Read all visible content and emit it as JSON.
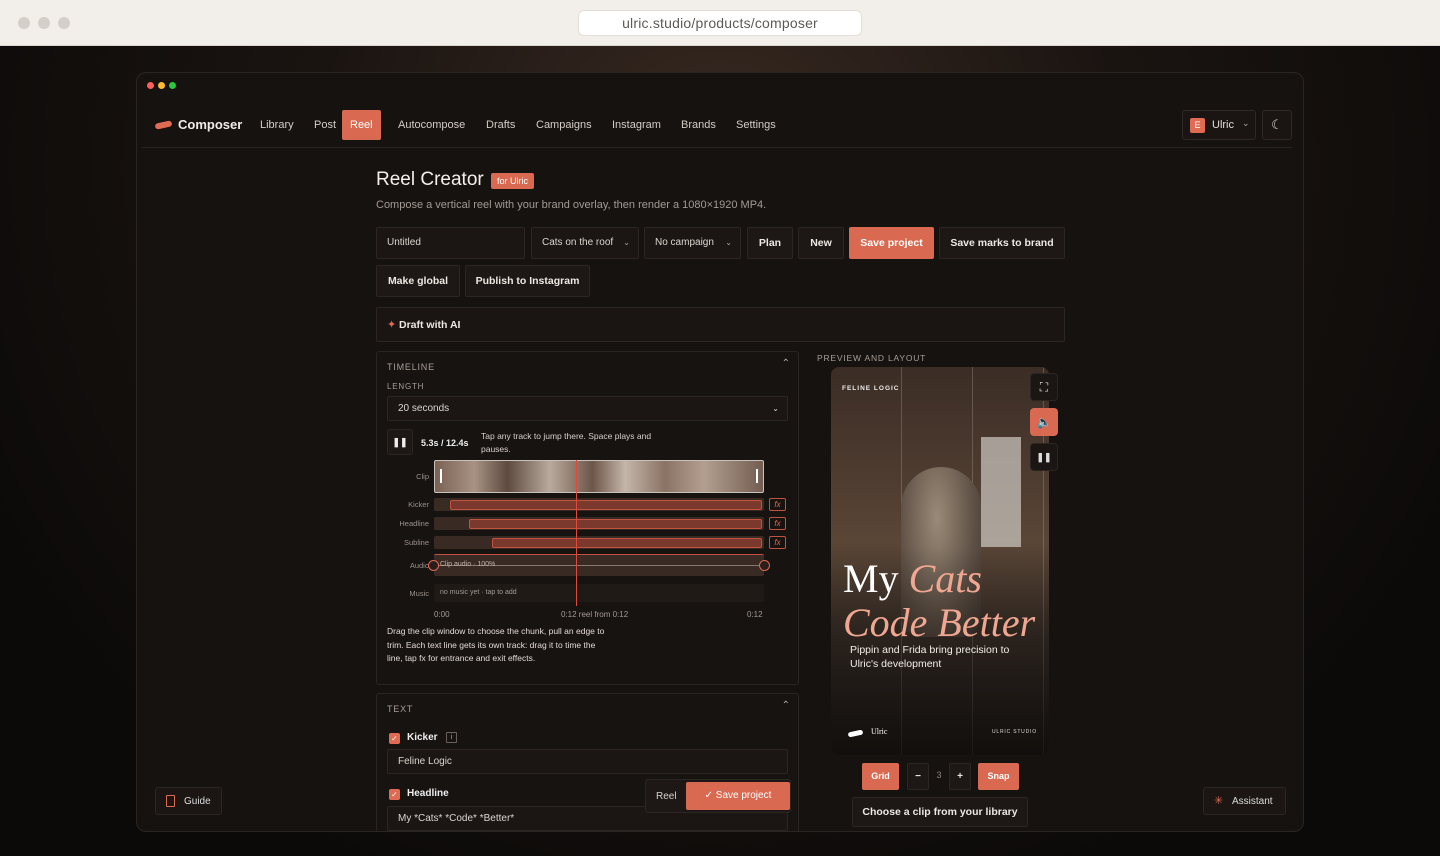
{
  "browser": {
    "url": "ulric.studio/products/composer"
  },
  "brand": {
    "name": "Composer",
    "accent": "#d96a51"
  },
  "nav": {
    "items": [
      "Library",
      "Post",
      "Reel",
      "Autocompose",
      "Drafts",
      "Campaigns",
      "Instagram",
      "Brands",
      "Settings"
    ],
    "active": "Reel",
    "user": {
      "initial": "E",
      "name": "Ulric"
    }
  },
  "header": {
    "title": "Reel Creator",
    "badge": "for Ulric",
    "subtitle": "Compose a vertical reel with your brand overlay, then render a 1080×1920 MP4."
  },
  "toolbar": {
    "project_name": "Untitled",
    "clip_select": "Cats on the roof",
    "campaign_select": "No campaign",
    "plan": "Plan",
    "new": "New",
    "save_project": "Save project",
    "save_marks": "Save marks to brand",
    "make_global": "Make global",
    "publish": "Publish to Instagram"
  },
  "ai": {
    "label": "Draft with AI",
    "icon": "sparkle-icon"
  },
  "timeline": {
    "title": "TIMELINE",
    "length_label": "LENGTH",
    "length_value": "20 seconds",
    "time": "5.3s / 12.4s",
    "hint": "Tap any track to jump there. Space plays and pauses.",
    "tracks": [
      "Clip",
      "Kicker",
      "Headline",
      "Subline",
      "Audio",
      "Music"
    ],
    "audio_label": "Clip audio · 100%",
    "music_label": "no music yet · tap to add",
    "fx_label": "fx",
    "ruler": {
      "start": "0:00",
      "mid": "0:12 reel from 0:12",
      "end": "0:12"
    },
    "help": "Drag the clip window to choose the chunk, pull an edge to trim. Each text line gets its own track: drag it to time the line, tap fx for entrance and exit effects."
  },
  "text_panel": {
    "title": "TEXT",
    "kicker_label": "Kicker",
    "kicker_value": "Feline Logic",
    "headline_label": "Headline",
    "headline_value": "My *Cats* *Code* *Better*"
  },
  "float_bar": {
    "reel": "Reel",
    "save": "Save project"
  },
  "preview": {
    "title": "PREVIEW AND LAYOUT",
    "kicker": "FELINE LOGIC",
    "headline_plain_1": "My",
    "headline_accent_1": "Cats",
    "headline_accent_2": "Code Better",
    "subline": "Pippin and Frida bring precision to Ulric's development",
    "brand": "Ulric",
    "studio": "ULRIC STUDIO",
    "grid": "Grid",
    "minus": "−",
    "count": "3",
    "plus": "+",
    "snap": "Snap",
    "choose_clip": "Choose a clip from your library"
  },
  "footer": {
    "guide": "Guide",
    "assistant": "Assistant"
  }
}
